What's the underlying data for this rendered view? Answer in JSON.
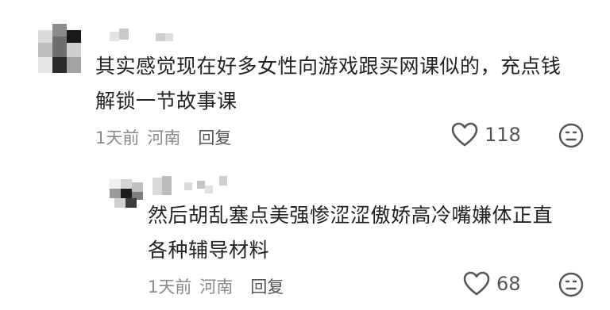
{
  "comments": [
    {
      "text_line1": "其实感觉现在好多女性向游戏跟买网课似的，充点钱",
      "text_line2": "解锁一节故事课",
      "time": "1天前",
      "location": "河南",
      "reply_label": "回复",
      "like_count": "118"
    },
    {
      "text_line1": "然后胡乱塞点美强惨涩涩傲娇高冷嘴嫌体正直",
      "text_line2": "各种辅导材料",
      "time": "1天前",
      "location": "河南",
      "reply_label": "回复",
      "like_count": "68"
    }
  ],
  "icons": {
    "like": "heart-outline-icon",
    "dislike": "frown-face-icon"
  },
  "colors": {
    "text": "#222222",
    "meta": "#8a8a8a",
    "icon": "#555555"
  }
}
